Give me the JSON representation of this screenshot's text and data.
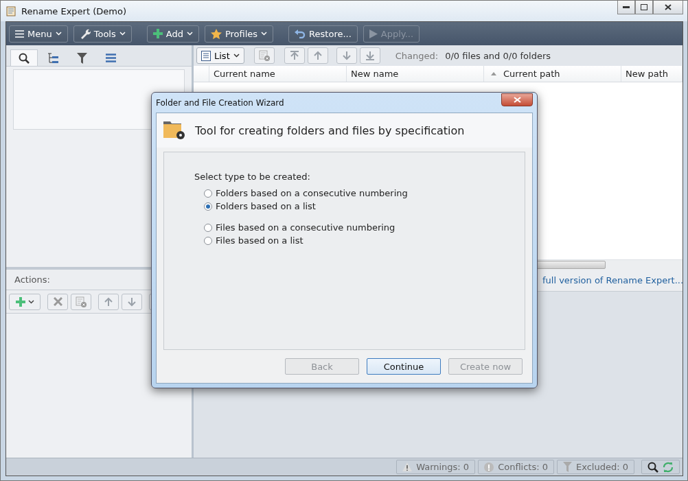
{
  "window": {
    "title": "Rename Expert (Demo)"
  },
  "toolbar": [
    {
      "label": "Menu",
      "kind": "menu",
      "disabled": false,
      "caret": true
    },
    {
      "label": "Tools",
      "kind": "tools",
      "disabled": false,
      "caret": true
    },
    {
      "label": "Add",
      "kind": "add",
      "disabled": false,
      "caret": true
    },
    {
      "label": "Profiles",
      "kind": "profiles",
      "disabled": false,
      "caret": true
    },
    {
      "label": "Restore...",
      "kind": "restore",
      "disabled": false,
      "caret": false
    },
    {
      "label": "Apply...",
      "kind": "apply",
      "disabled": true,
      "caret": false
    }
  ],
  "left_tabs": [
    {
      "kind": "search",
      "selected": true
    },
    {
      "kind": "tree",
      "selected": false
    },
    {
      "kind": "filter",
      "selected": false
    },
    {
      "kind": "list",
      "selected": false
    }
  ],
  "actions": {
    "label": "Actions:"
  },
  "list_toolbar": {
    "view": "List",
    "changed_label": "Changed:",
    "changed_value": "0/0 files and 0/0 folders"
  },
  "table": {
    "columns": [
      {
        "label": "Current name",
        "sorted": false
      },
      {
        "label": "New name",
        "sorted": false
      },
      {
        "label": "Current path",
        "sorted": true
      },
      {
        "label": "New path",
        "sorted": false
      }
    ]
  },
  "link": "full version of Rename Expert...",
  "status_bar": [
    {
      "kind": "warning",
      "label": "Warnings: 0"
    },
    {
      "kind": "conflict",
      "label": "Conflicts: 0"
    },
    {
      "kind": "excluded",
      "label": "Excluded: 0"
    }
  ],
  "dialog": {
    "title": "Folder and File Creation Wizard",
    "heading": "Tool for creating folders and files by specification",
    "prompt": "Select type to be created:",
    "groups": [
      [
        {
          "label": "Folders based on a consecutive numbering",
          "selected": false
        },
        {
          "label": "Folders based on a list",
          "selected": true
        }
      ],
      [
        {
          "label": "Files based on a consecutive numbering",
          "selected": false
        },
        {
          "label": "Files based on a list",
          "selected": false
        }
      ]
    ],
    "buttons": [
      {
        "label": "Back",
        "disabled": true,
        "default": false
      },
      {
        "label": "Continue",
        "disabled": false,
        "default": true
      },
      {
        "label": "Create now",
        "disabled": true,
        "default": false
      }
    ]
  }
}
